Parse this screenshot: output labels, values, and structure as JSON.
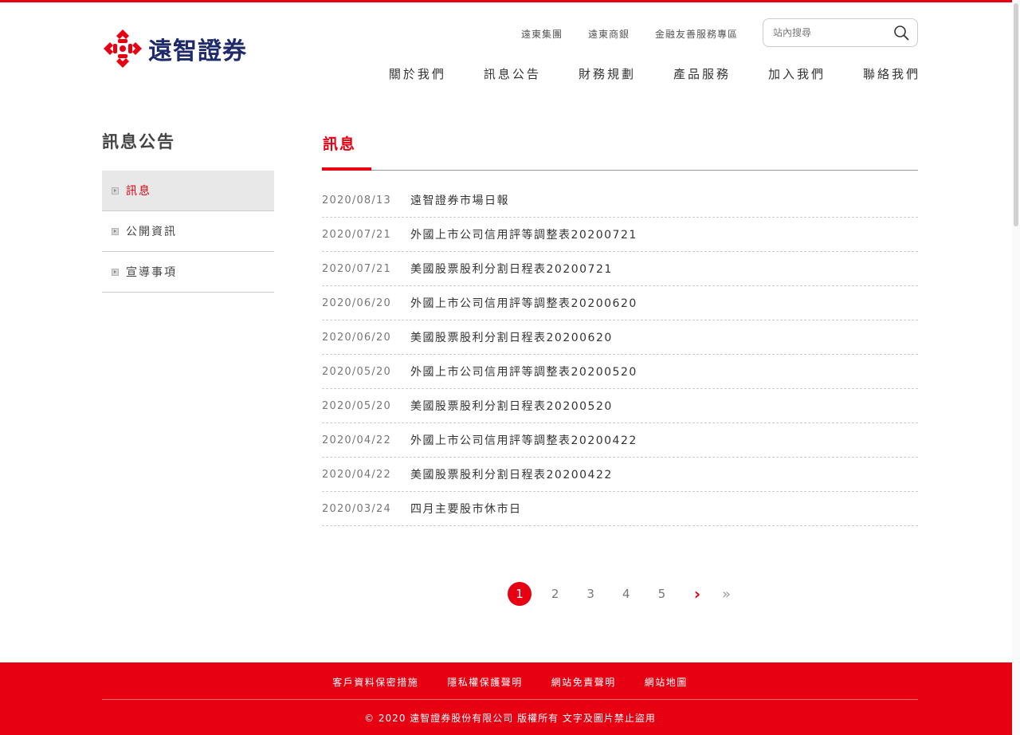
{
  "brand": {
    "name": "遠智證券",
    "logo_color": "#e60012",
    "text_color": "#1f2a6b"
  },
  "top_links": [
    "遠東集團",
    "遠東商銀",
    "金融友善服務專區"
  ],
  "search": {
    "placeholder": "站內搜尋",
    "icon": "search-icon"
  },
  "main_nav": [
    "關於我們",
    "訊息公告",
    "財務規劃",
    "產品服務",
    "加入我們",
    "聯絡我們"
  ],
  "sidebar": {
    "title": "訊息公告",
    "items": [
      {
        "label": "訊息",
        "active": true
      },
      {
        "label": "公開資訊",
        "active": false
      },
      {
        "label": "宣導事項",
        "active": false
      }
    ]
  },
  "content": {
    "title": "訊息",
    "news": [
      {
        "date": "2020/08/13",
        "title": "遠智證券市場日報"
      },
      {
        "date": "2020/07/21",
        "title": "外國上市公司信用評等調整表20200721"
      },
      {
        "date": "2020/07/21",
        "title": "美國股票股利分割日程表20200721"
      },
      {
        "date": "2020/06/20",
        "title": "外國上市公司信用評等調整表20200620"
      },
      {
        "date": "2020/06/20",
        "title": "美國股票股利分割日程表20200620"
      },
      {
        "date": "2020/05/20",
        "title": "外國上市公司信用評等調整表20200520"
      },
      {
        "date": "2020/05/20",
        "title": "美國股票股利分割日程表20200520"
      },
      {
        "date": "2020/04/22",
        "title": "外國上市公司信用評等調整表20200422"
      },
      {
        "date": "2020/04/22",
        "title": "美國股票股利分割日程表20200422"
      },
      {
        "date": "2020/03/24",
        "title": "四月主要股市休市日"
      }
    ]
  },
  "pagination": {
    "pages": [
      "1",
      "2",
      "3",
      "4",
      "5"
    ],
    "current": "1",
    "next": "›",
    "last": "»"
  },
  "footer": {
    "links": [
      "客戶資料保密措施",
      "隱私權保護聲明",
      "網站免責聲明",
      "網站地圖"
    ],
    "copyright": "© 2020 遠智證券股份有限公司 版權所有 文字及圖片禁止盜用",
    "bg_color": "#e60012"
  }
}
